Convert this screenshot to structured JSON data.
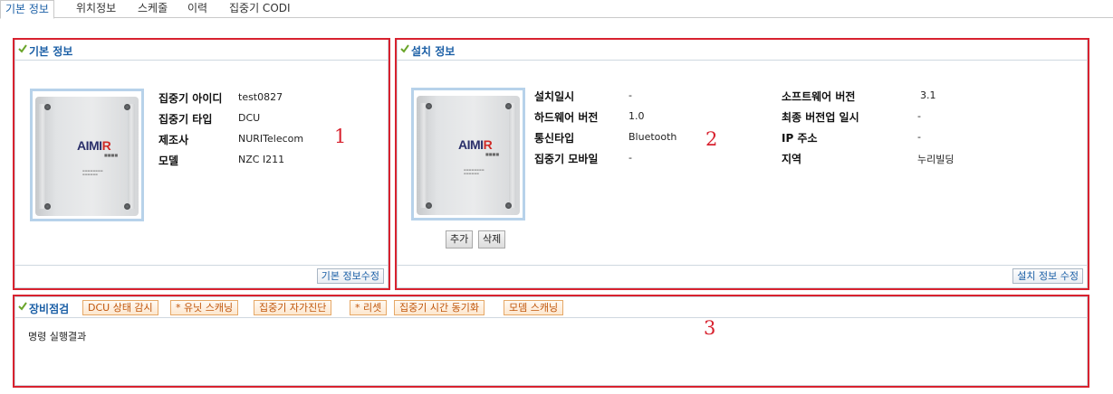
{
  "tabs": [
    {
      "label": "기본 정보",
      "active": true
    },
    {
      "label": "위치정보",
      "active": false
    },
    {
      "label": "스케줄",
      "active": false
    },
    {
      "label": "이력",
      "active": false
    },
    {
      "label": "집중기 CODI",
      "active": false
    }
  ],
  "basic_panel": {
    "title": "기본 정보",
    "fields": [
      {
        "label": "집중기 아이디",
        "value": "test0827"
      },
      {
        "label": "집중기 타입",
        "value": "DCU"
      },
      {
        "label": "제조사",
        "value": "NURITelecom"
      },
      {
        "label": "모델",
        "value": "NZC I211"
      }
    ],
    "edit_button": "기본 정보수정"
  },
  "install_panel": {
    "title": "설치 정보",
    "left_fields": [
      {
        "label": "설치일시",
        "value": "-"
      },
      {
        "label": "하드웨어 버전",
        "value": "1.0"
      },
      {
        "label": "통신타입",
        "value": "Bluetooth"
      },
      {
        "label": "집중기 모바일",
        "value": "-"
      }
    ],
    "right_fields": [
      {
        "label": "소프트웨어 버전",
        "value": "3.1"
      },
      {
        "label": "최종 버전업 일시",
        "value": "-"
      },
      {
        "label": "IP 주소",
        "value": "-"
      },
      {
        "label": "지역",
        "value": "누리빌딩"
      }
    ],
    "add_button": "추가",
    "delete_button": "삭제",
    "edit_button": "설치 정보 수정"
  },
  "inspection_panel": {
    "title": "장비점검",
    "buttons": [
      "DCU 상태 감시",
      "* 유닛 스캐닝",
      "집중기 자가진단",
      "* 리셋",
      "집중기 시간 동기화",
      "모뎀 스캐닝"
    ],
    "result_label": "명령 실행결과"
  },
  "device_image": {
    "logo_text_a": "AIMI",
    "logo_text_b": "R"
  },
  "annotations": [
    "1",
    "2",
    "3"
  ],
  "colors": {
    "accent": "#1b5fa6",
    "annotation_red": "#d8222f",
    "orange_button": "#c0560b",
    "check_green": "#6aa52a"
  }
}
